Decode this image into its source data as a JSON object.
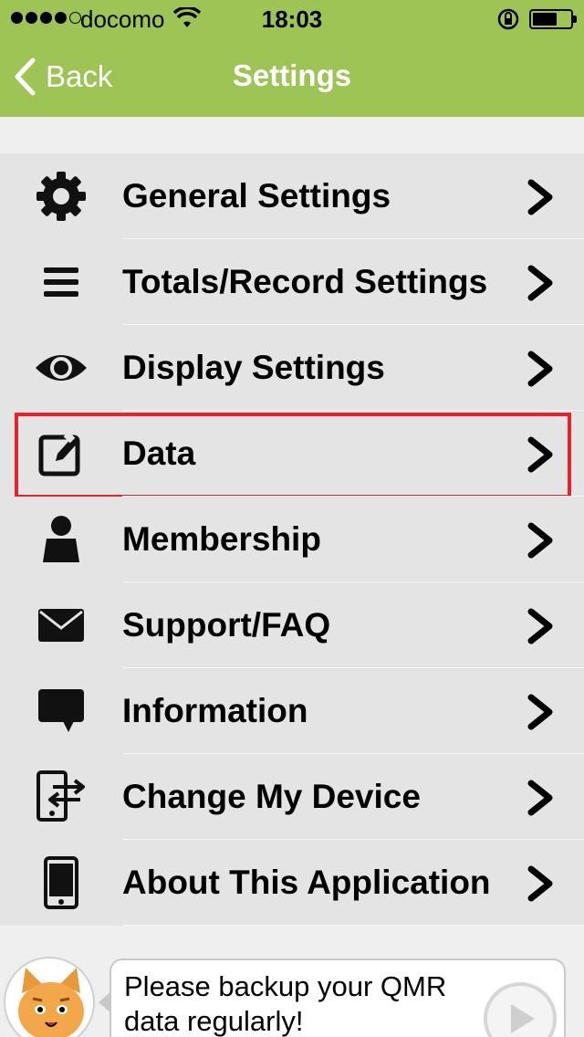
{
  "status_bar": {
    "carrier": "docomo",
    "time": "18:03",
    "signal_bars_filled": 4,
    "signal_bars_total": 5,
    "battery_level": 0.55
  },
  "nav": {
    "back_label": "Back",
    "title": "Settings"
  },
  "settings": {
    "items": [
      {
        "label": "General Settings",
        "icon": "gear-icon"
      },
      {
        "label": "Totals/Record Settings",
        "icon": "menu-lines-icon"
      },
      {
        "label": "Display Settings",
        "icon": "eye-icon"
      },
      {
        "label": "Data",
        "icon": "edit-icon",
        "highlighted": true
      },
      {
        "label": "Membership",
        "icon": "person-icon"
      },
      {
        "label": "Support/FAQ",
        "icon": "envelope-icon"
      },
      {
        "label": "Information",
        "icon": "speech-bubble-icon"
      },
      {
        "label": "Change My Device",
        "icon": "device-transfer-icon"
      },
      {
        "label": "About This Application",
        "icon": "phone-icon"
      }
    ]
  },
  "footer": {
    "message": "Please backup your QMR data regularly!"
  },
  "colors": {
    "nav_background": "#9ec455",
    "list_background": "#e4e4e4",
    "highlight_border": "#e8222b"
  }
}
